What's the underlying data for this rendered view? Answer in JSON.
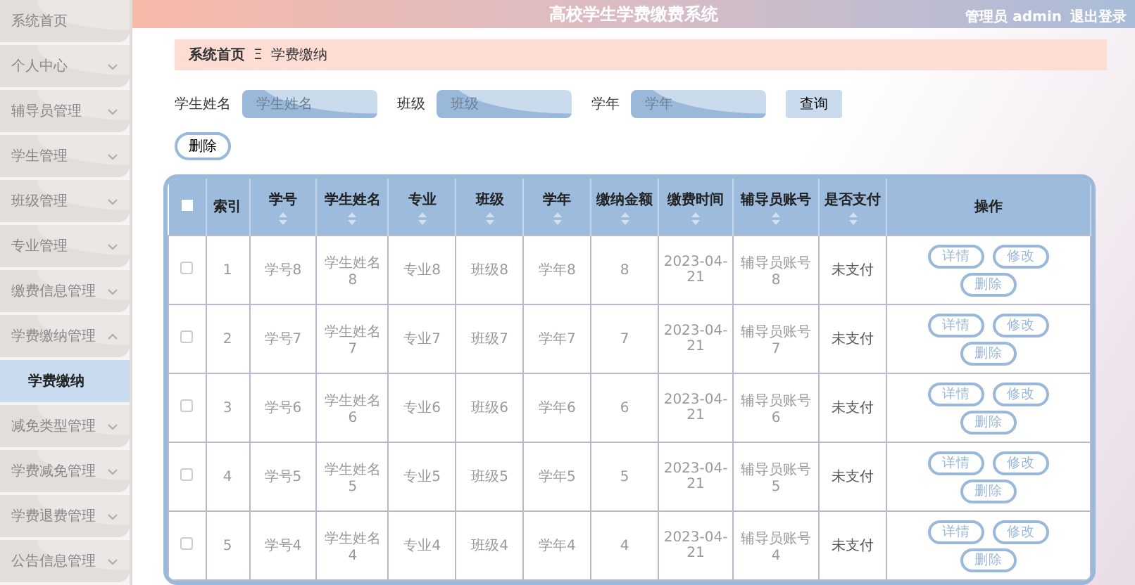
{
  "sidebar": {
    "items": [
      {
        "label": "系统首页",
        "kind": "link"
      },
      {
        "label": "个人中心",
        "kind": "menu",
        "expanded": false
      },
      {
        "label": "辅导员管理",
        "kind": "menu",
        "expanded": false
      },
      {
        "label": "学生管理",
        "kind": "menu",
        "expanded": false
      },
      {
        "label": "班级管理",
        "kind": "menu",
        "expanded": false
      },
      {
        "label": "专业管理",
        "kind": "menu",
        "expanded": false
      },
      {
        "label": "缴费信息管理",
        "kind": "menu",
        "expanded": false
      },
      {
        "label": "学费缴纳管理",
        "kind": "menu",
        "expanded": true,
        "children": [
          {
            "label": "学费缴纳",
            "selected": true
          }
        ]
      },
      {
        "label": "减免类型管理",
        "kind": "menu",
        "expanded": false
      },
      {
        "label": "学费减免管理",
        "kind": "menu",
        "expanded": false
      },
      {
        "label": "学费退费管理",
        "kind": "menu",
        "expanded": false
      },
      {
        "label": "公告信息管理",
        "kind": "menu",
        "expanded": false
      }
    ]
  },
  "header": {
    "title": "高校学生学费缴费系统",
    "user": "管理员 admin",
    "logout": "退出登录"
  },
  "breadcrumb": [
    "系统首页",
    "学费缴纳"
  ],
  "breadcrumb_separator": "Ξ",
  "search": {
    "fields": [
      {
        "label": "学生姓名",
        "placeholder": "学生姓名"
      },
      {
        "label": "班级",
        "placeholder": "班级"
      },
      {
        "label": "学年",
        "placeholder": "学年"
      }
    ],
    "button": "查询"
  },
  "delete_button": "删除",
  "table": {
    "select_all_checked": false,
    "columns": [
      {
        "label": "索引",
        "sortable": false
      },
      {
        "label": "学号",
        "sortable": true
      },
      {
        "label": "学生姓名",
        "sortable": true
      },
      {
        "label": "专业",
        "sortable": true
      },
      {
        "label": "班级",
        "sortable": true
      },
      {
        "label": "学年",
        "sortable": true
      },
      {
        "label": "缴纳金额",
        "sortable": true
      },
      {
        "label": "缴费时间",
        "sortable": true
      },
      {
        "label": "辅导员账号",
        "sortable": true
      },
      {
        "label": "是否支付",
        "sortable": true
      },
      {
        "label": "操作",
        "sortable": false
      }
    ],
    "rows": [
      {
        "checked": false,
        "cells": [
          "1",
          "学号8",
          "学生姓名8",
          "专业8",
          "班级8",
          "学年8",
          "8",
          "2023-04-21",
          "辅导员账号8",
          "未支付"
        ],
        "actions": [
          "详情",
          "修改",
          "删除"
        ]
      },
      {
        "checked": false,
        "cells": [
          "2",
          "学号7",
          "学生姓名7",
          "专业7",
          "班级7",
          "学年7",
          "7",
          "2023-04-21",
          "辅导员账号7",
          "未支付"
        ],
        "actions": [
          "详情",
          "修改",
          "删除"
        ]
      },
      {
        "checked": false,
        "cells": [
          "3",
          "学号6",
          "学生姓名6",
          "专业6",
          "班级6",
          "学年6",
          "6",
          "2023-04-21",
          "辅导员账号6",
          "未支付"
        ],
        "actions": [
          "详情",
          "修改",
          "删除"
        ]
      },
      {
        "checked": false,
        "cells": [
          "4",
          "学号5",
          "学生姓名5",
          "专业5",
          "班级5",
          "学年5",
          "5",
          "2023-04-21",
          "辅导员账号5",
          "未支付"
        ],
        "actions": [
          "详情",
          "修改",
          "删除"
        ]
      },
      {
        "checked": false,
        "cells": [
          "5",
          "学号4",
          "学生姓名4",
          "专业4",
          "班级4",
          "学年4",
          "4",
          "2023-04-21",
          "辅导员账号4",
          "未支付"
        ],
        "actions": [
          "详情",
          "修改",
          "删除"
        ]
      }
    ]
  }
}
